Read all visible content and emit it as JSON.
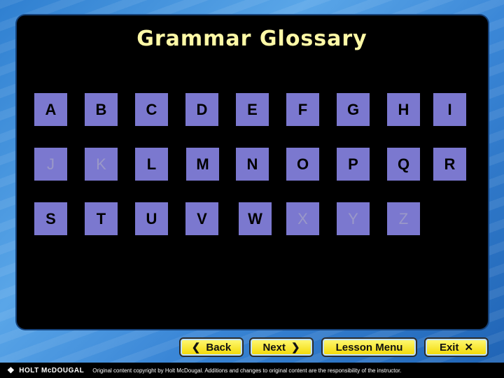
{
  "title": "Grammar Glossary",
  "letters": {
    "A": "A",
    "B": "B",
    "C": "C",
    "D": "D",
    "E": "E",
    "F": "F",
    "G": "G",
    "H": "H",
    "I": "I",
    "J": "J",
    "K": "K",
    "L": "L",
    "M": "M",
    "N": "N",
    "O": "O",
    "P": "P",
    "Q": "Q",
    "R": "R",
    "S": "S",
    "T": "T",
    "U": "U",
    "V": "V",
    "W": "W",
    "X": "X",
    "Y": "Y",
    "Z": "Z"
  },
  "nav": {
    "back": "Back",
    "next": "Next",
    "lesson_menu": "Lesson Menu",
    "exit": "Exit"
  },
  "footer": {
    "logo": "HOLT McDOUGAL",
    "copyright": "Original content copyright by Holt McDougal. Additions and changes to original content are the responsibility of the instructor."
  },
  "colors": {
    "tile": "#7b78cf",
    "title": "#fff9a6",
    "button": "#f2d800"
  }
}
